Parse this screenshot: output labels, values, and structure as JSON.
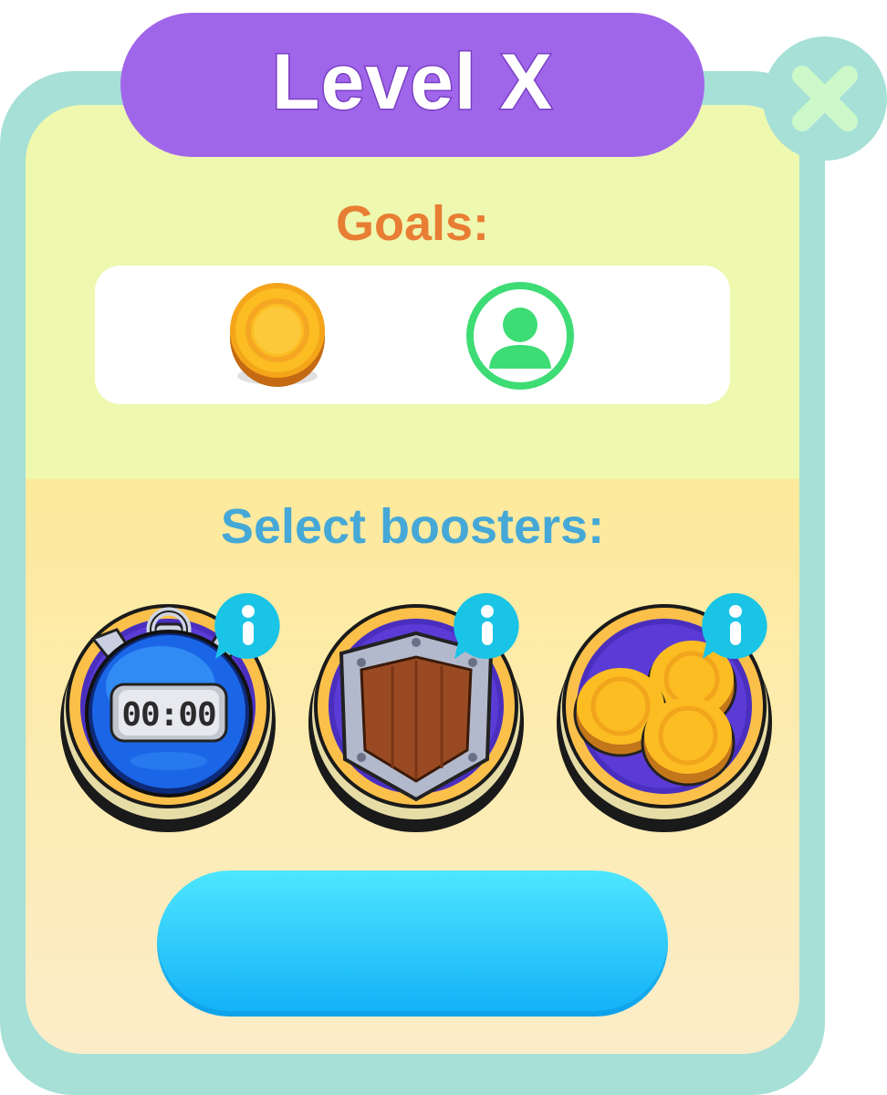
{
  "header": {
    "title": "Level X",
    "close_icon": "close-x-icon"
  },
  "goals": {
    "label": "Goals:",
    "items": [
      {
        "icon": "gold-coin-icon"
      },
      {
        "icon": "user-avatar-icon"
      }
    ]
  },
  "boosters": {
    "label": "Select boosters:",
    "items": [
      {
        "icon": "stopwatch-icon",
        "display": "00:00",
        "info_icon": "info-icon"
      },
      {
        "icon": "shield-icon",
        "info_icon": "info-icon"
      },
      {
        "icon": "coin-stack-icon",
        "info_icon": "info-icon"
      }
    ]
  },
  "play_button": {
    "label": ""
  },
  "colors": {
    "frame": "#a6e0d7",
    "title_pill": "#a066ea",
    "goals_text": "#e87d34",
    "boosters_text": "#46a8d6",
    "button_top": "#4ee6ff",
    "button_bottom": "#12b0f7"
  }
}
